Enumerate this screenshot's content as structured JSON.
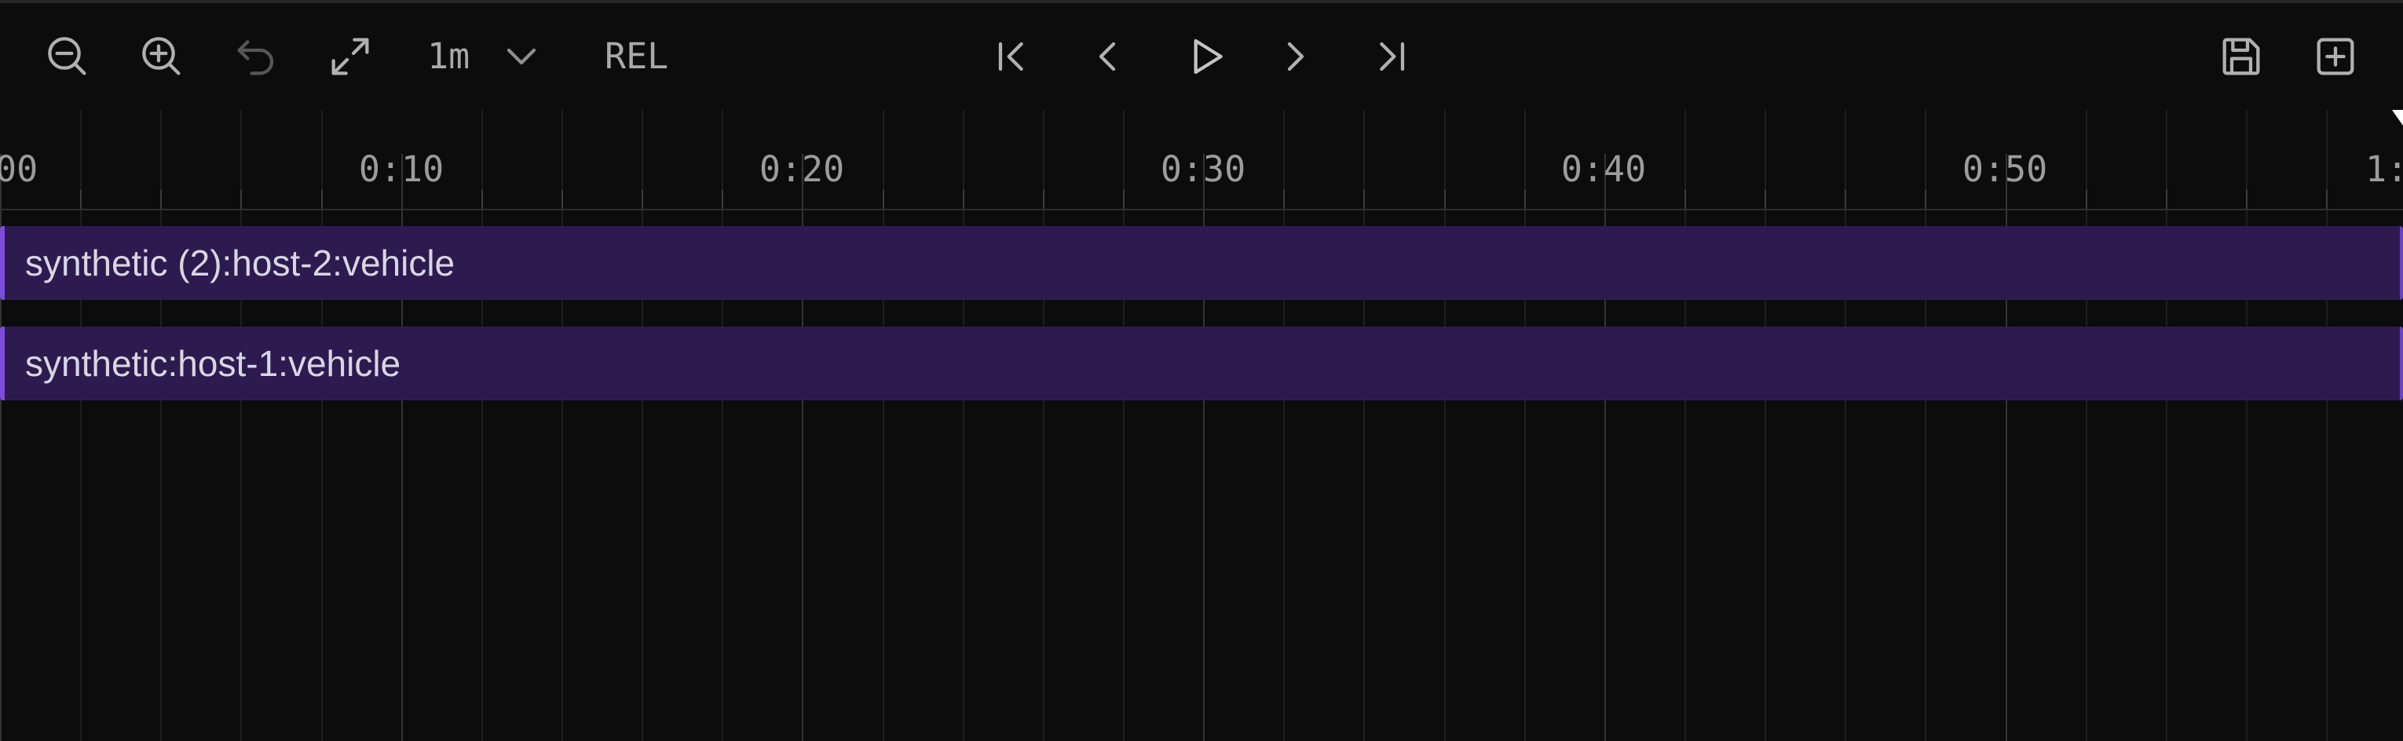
{
  "toolbar": {
    "left": [
      {
        "name": "zoom-out-button",
        "icon": "zoom-out-icon",
        "disabled": false
      },
      {
        "name": "zoom-in-button",
        "icon": "zoom-in-icon",
        "disabled": false
      },
      {
        "name": "undo-button",
        "icon": "undo-icon",
        "disabled": true
      },
      {
        "name": "fit-button",
        "icon": "expand-icon",
        "disabled": false
      }
    ],
    "range_select": {
      "value": "1m",
      "icon": "chevron-down-icon"
    },
    "time_mode": "REL",
    "playback": [
      {
        "name": "skip-to-start-button",
        "icon": "skip-start-icon"
      },
      {
        "name": "step-back-button",
        "icon": "chevron-left-icon"
      },
      {
        "name": "play-button",
        "icon": "play-icon"
      },
      {
        "name": "step-forward-button",
        "icon": "chevron-right-icon"
      },
      {
        "name": "skip-to-end-button",
        "icon": "skip-end-icon"
      }
    ],
    "right": [
      {
        "name": "save-button",
        "icon": "save-icon"
      },
      {
        "name": "add-button",
        "icon": "plus-square-icon"
      }
    ]
  },
  "timeline": {
    "axis_labels": [
      "00",
      "0:10",
      "0:20",
      "0:30",
      "0:40",
      "0:50",
      "1:"
    ],
    "tracks": [
      {
        "label": "synthetic (2):host-2:vehicle"
      },
      {
        "label": "synthetic:host-1:vehicle"
      }
    ]
  },
  "colors": {
    "background": "#0c0c0c",
    "track_fill": "#2d1b4f",
    "track_edge": "#7c4ddb",
    "text": "#a9a9a9"
  }
}
